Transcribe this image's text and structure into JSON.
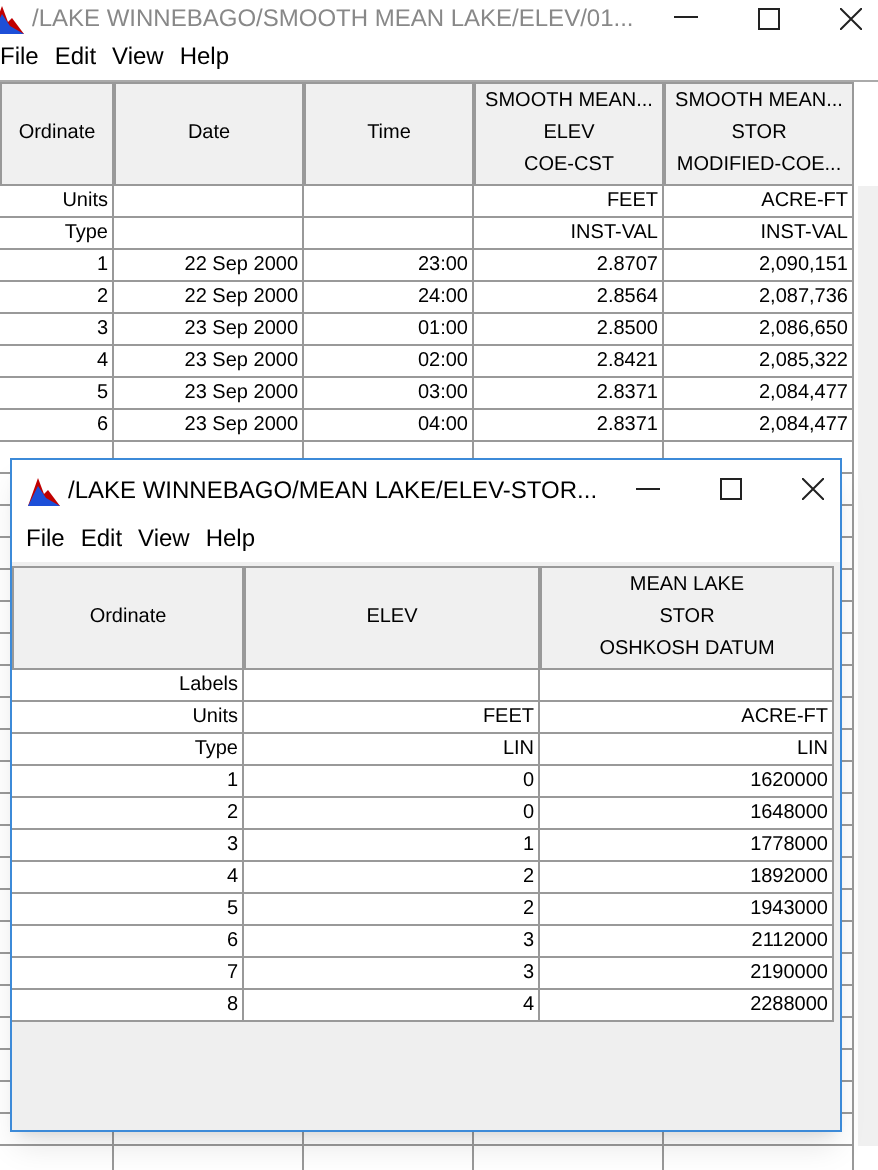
{
  "back_window": {
    "title": "/LAKE WINNEBAGO/SMOOTH MEAN LAKE/ELEV/01...",
    "menu": [
      "File",
      "Edit",
      "View",
      "Help"
    ],
    "table": {
      "columns": [
        "Ordinate",
        "Date",
        "Time",
        "SMOOTH MEAN...\nELEV\nCOE-CST",
        "SMOOTH MEAN...\nSTOR\nMODIFIED-COE..."
      ],
      "rows": [
        [
          "Units",
          "",
          "",
          "FEET",
          "ACRE-FT"
        ],
        [
          "Type",
          "",
          "",
          "INST-VAL",
          "INST-VAL"
        ],
        [
          "1",
          "22 Sep 2000",
          "23:00",
          "2.8707",
          "2,090,151"
        ],
        [
          "2",
          "22 Sep 2000",
          "24:00",
          "2.8564",
          "2,087,736"
        ],
        [
          "3",
          "23 Sep 2000",
          "01:00",
          "2.8500",
          "2,086,650"
        ],
        [
          "4",
          "23 Sep 2000",
          "02:00",
          "2.8421",
          "2,085,322"
        ],
        [
          "5",
          "23 Sep 2000",
          "03:00",
          "2.8371",
          "2,084,477"
        ],
        [
          "6",
          "23 Sep 2000",
          "04:00",
          "2.8371",
          "2,084,477"
        ]
      ]
    }
  },
  "front_window": {
    "title": "/LAKE WINNEBAGO/MEAN LAKE/ELEV-STOR...",
    "menu": [
      "File",
      "Edit",
      "View",
      "Help"
    ],
    "table": {
      "columns": [
        "Ordinate",
        "ELEV",
        "MEAN LAKE\nSTOR\nOSHKOSH DATUM"
      ],
      "rows": [
        [
          "Labels",
          "",
          ""
        ],
        [
          "Units",
          "FEET",
          "ACRE-FT"
        ],
        [
          "Type",
          "LIN",
          "LIN"
        ],
        [
          "1",
          "0",
          "1620000"
        ],
        [
          "2",
          "0",
          "1648000"
        ],
        [
          "3",
          "1",
          "1778000"
        ],
        [
          "4",
          "2",
          "1892000"
        ],
        [
          "5",
          "2",
          "1943000"
        ],
        [
          "6",
          "3",
          "2112000"
        ],
        [
          "7",
          "3",
          "2190000"
        ],
        [
          "8",
          "4",
          "2288000"
        ]
      ]
    }
  }
}
